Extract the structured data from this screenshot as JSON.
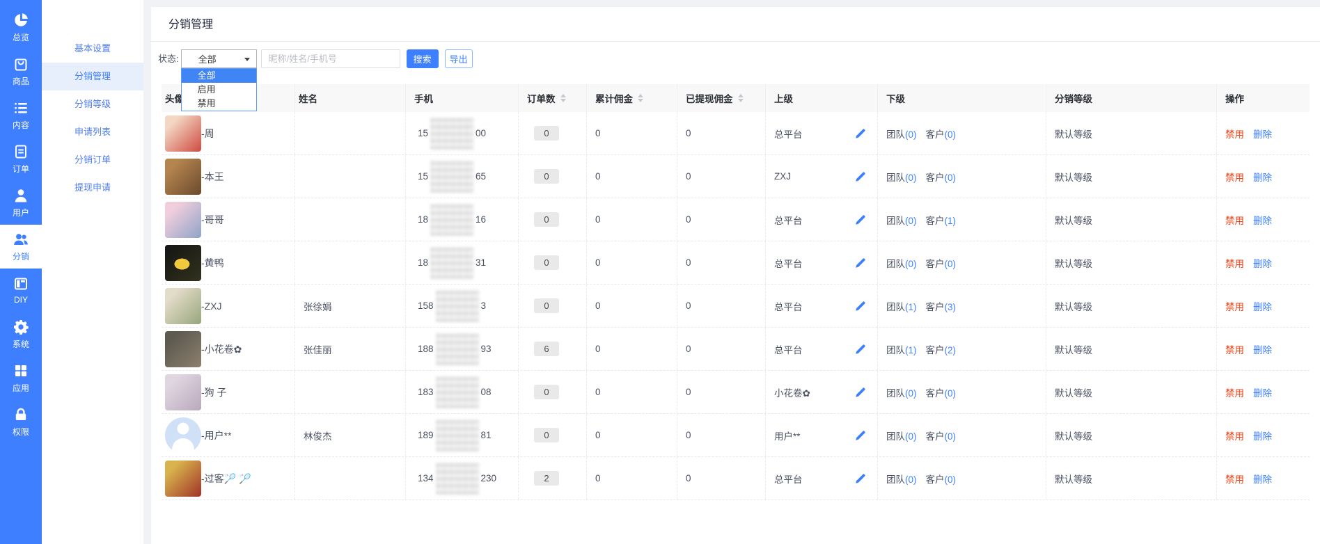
{
  "colors": {
    "accent": "#3D7FFF",
    "danger": "#ed4014",
    "selected_option_bg": "#3f85f5"
  },
  "sidebar": {
    "items": [
      {
        "label": "总览",
        "icon": "pie-chart-icon",
        "active": false
      },
      {
        "label": "商品",
        "icon": "bag-icon",
        "active": false
      },
      {
        "label": "内容",
        "icon": "list-icon",
        "active": false
      },
      {
        "label": "订单",
        "icon": "document-icon",
        "active": false
      },
      {
        "label": "用户",
        "icon": "user-icon",
        "active": false
      },
      {
        "label": "分销",
        "icon": "users-icon",
        "active": true
      },
      {
        "label": "DIY",
        "icon": "layout-icon",
        "active": false
      },
      {
        "label": "系统",
        "icon": "gear-icon",
        "active": false
      },
      {
        "label": "应用",
        "icon": "grid-icon",
        "active": false
      },
      {
        "label": "权限",
        "icon": "lock-icon",
        "active": false
      }
    ]
  },
  "submenu": {
    "items": [
      {
        "label": "基本设置",
        "active": false
      },
      {
        "label": "分销管理",
        "active": true
      },
      {
        "label": "分销等级",
        "active": false
      },
      {
        "label": "申请列表",
        "active": false
      },
      {
        "label": "分销订单",
        "active": false
      },
      {
        "label": "提现申请",
        "active": false
      }
    ]
  },
  "page": {
    "title": "分销管理"
  },
  "filters": {
    "status_label": "状态:",
    "status_value": "全部",
    "options": [
      "全部",
      "启用",
      "禁用"
    ],
    "selected_option": "全部",
    "search_placeholder": "昵称/姓名/手机号",
    "search_button": "搜索",
    "export_button": "导出"
  },
  "table": {
    "columns": [
      {
        "label": "头像",
        "sortable": false
      },
      {
        "label": "姓名",
        "sortable": false
      },
      {
        "label": "手机",
        "sortable": false
      },
      {
        "label": "订单数",
        "sortable": true
      },
      {
        "label": "累计佣金",
        "sortable": true
      },
      {
        "label": "已提现佣金",
        "sortable": true
      },
      {
        "label": "上级",
        "sortable": false
      },
      {
        "label": "下级",
        "sortable": false
      },
      {
        "label": "分销等级",
        "sortable": false
      },
      {
        "label": "操作",
        "sortable": false
      }
    ],
    "sub_labels": {
      "team": "团队",
      "customer": "客户"
    },
    "actions": {
      "disable": "禁用",
      "delete": "删除"
    },
    "rows": [
      {
        "nickname": "-周",
        "name": "",
        "phone_prefix": "15",
        "phone_suffix": "00",
        "orders": "0",
        "commission": "0",
        "withdrawn": "0",
        "parent": "总平台",
        "team": "0",
        "customers": "0",
        "level": "默认等级",
        "avatar": [
          "#f3d7c3",
          "#cf4a41"
        ],
        "avatar_default": false,
        "avatar_duck": false
      },
      {
        "nickname": "-本王",
        "name": "",
        "phone_prefix": "15",
        "phone_suffix": "65",
        "orders": "0",
        "commission": "0",
        "withdrawn": "0",
        "parent": "ZXJ",
        "team": "0",
        "customers": "0",
        "level": "默认等级",
        "avatar": [
          "#b5854f",
          "#6b4a2e"
        ],
        "avatar_default": false,
        "avatar_duck": false
      },
      {
        "nickname": "-哥哥",
        "name": "",
        "phone_prefix": "18",
        "phone_suffix": "16",
        "orders": "0",
        "commission": "0",
        "withdrawn": "0",
        "parent": "总平台",
        "team": "0",
        "customers": "1",
        "level": "默认等级",
        "avatar": [
          "#f2cedd",
          "#8fa3c7"
        ],
        "avatar_default": false,
        "avatar_duck": false
      },
      {
        "nickname": "-黄鸭",
        "name": "",
        "phone_prefix": "18",
        "phone_suffix": "31",
        "orders": "0",
        "commission": "0",
        "withdrawn": "0",
        "parent": "总平台",
        "team": "0",
        "customers": "0",
        "level": "默认等级",
        "avatar": [
          "#141414",
          "#32321e"
        ],
        "avatar_default": false,
        "avatar_duck": true
      },
      {
        "nickname": "-ZXJ",
        "name": "张徐娟",
        "phone_prefix": "158",
        "phone_suffix": "3",
        "orders": "0",
        "commission": "0",
        "withdrawn": "0",
        "parent": "总平台",
        "team": "1",
        "customers": "3",
        "level": "默认等级",
        "avatar": [
          "#e3dcc9",
          "#97a57c"
        ],
        "avatar_default": false,
        "avatar_duck": false
      },
      {
        "nickname": "-小花卷✿",
        "name": "张佳丽",
        "phone_prefix": "188",
        "phone_suffix": "93",
        "orders": "6",
        "commission": "0",
        "withdrawn": "0",
        "parent": "总平台",
        "team": "1",
        "customers": "2",
        "level": "默认等级",
        "avatar": [
          "#5d5a50",
          "#8d8070"
        ],
        "avatar_default": false,
        "avatar_duck": false
      },
      {
        "nickname": "-狗 子",
        "name": "",
        "phone_prefix": "183",
        "phone_suffix": "08",
        "orders": "0",
        "commission": "0",
        "withdrawn": "0",
        "parent": "小花卷✿",
        "team": "0",
        "customers": "0",
        "level": "默认等级",
        "avatar": [
          "#e0d6e0",
          "#b9a8bc"
        ],
        "avatar_default": false,
        "avatar_duck": false
      },
      {
        "nickname": "-用户**",
        "name": "林俊杰",
        "phone_prefix": "189",
        "phone_suffix": "81",
        "orders": "0",
        "commission": "0",
        "withdrawn": "0",
        "parent": "用户**",
        "team": "0",
        "customers": "0",
        "level": "默认等级",
        "avatar": [
          "#cfe0f7",
          "#cfe0f7"
        ],
        "avatar_default": true,
        "avatar_duck": false
      },
      {
        "nickname": "-过客🏸 🏸",
        "name": "",
        "phone_prefix": "134",
        "phone_suffix": "230",
        "orders": "2",
        "commission": "0",
        "withdrawn": "0",
        "parent": "总平台",
        "team": "0",
        "customers": "0",
        "level": "默认等级",
        "avatar": [
          "#d9b44e",
          "#a03226"
        ],
        "avatar_default": false,
        "avatar_duck": false
      }
    ]
  }
}
